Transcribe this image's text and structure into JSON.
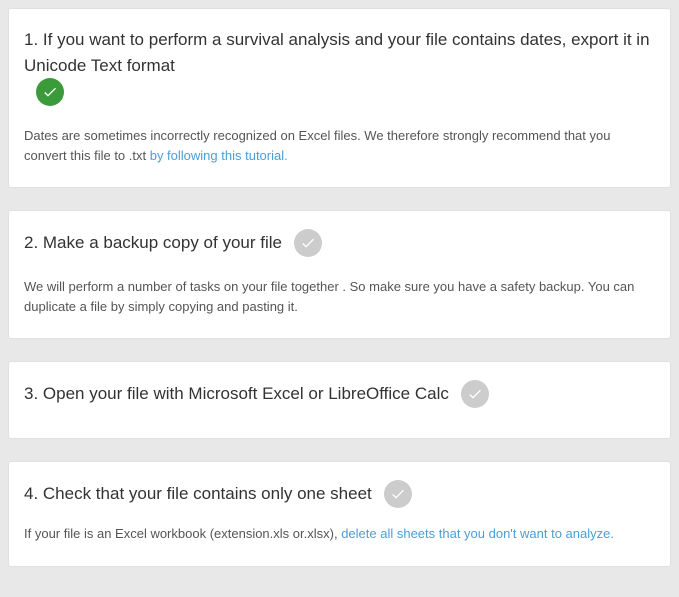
{
  "steps": [
    {
      "title": "1. If you want to perform a survival analysis and your file contains dates, export it in Unicode Text format",
      "status": "done",
      "body_prefix": "Dates are sometimes incorrectly recognized on Excel files. We therefore strongly recommend that you convert this file to .txt ",
      "link_text": "by following this tutorial.",
      "body_suffix": ""
    },
    {
      "title": "2. Make a backup copy of your file",
      "status": "pending",
      "body_prefix": "We will perform a number of tasks on your file together . So make sure you have a safety backup. You can duplicate a file by simply copying and pasting it.",
      "link_text": "",
      "body_suffix": ""
    },
    {
      "title": "3. Open your file with Microsoft Excel or LibreOffice Calc",
      "status": "pending",
      "body_prefix": "",
      "link_text": "",
      "body_suffix": ""
    },
    {
      "title": "4. Check that your file contains only one sheet",
      "status": "pending",
      "body_prefix": "If your file is an Excel workbook (extension.xls or.xlsx), ",
      "link_text": "delete all sheets that you don't want to analyze.",
      "body_suffix": ""
    }
  ]
}
